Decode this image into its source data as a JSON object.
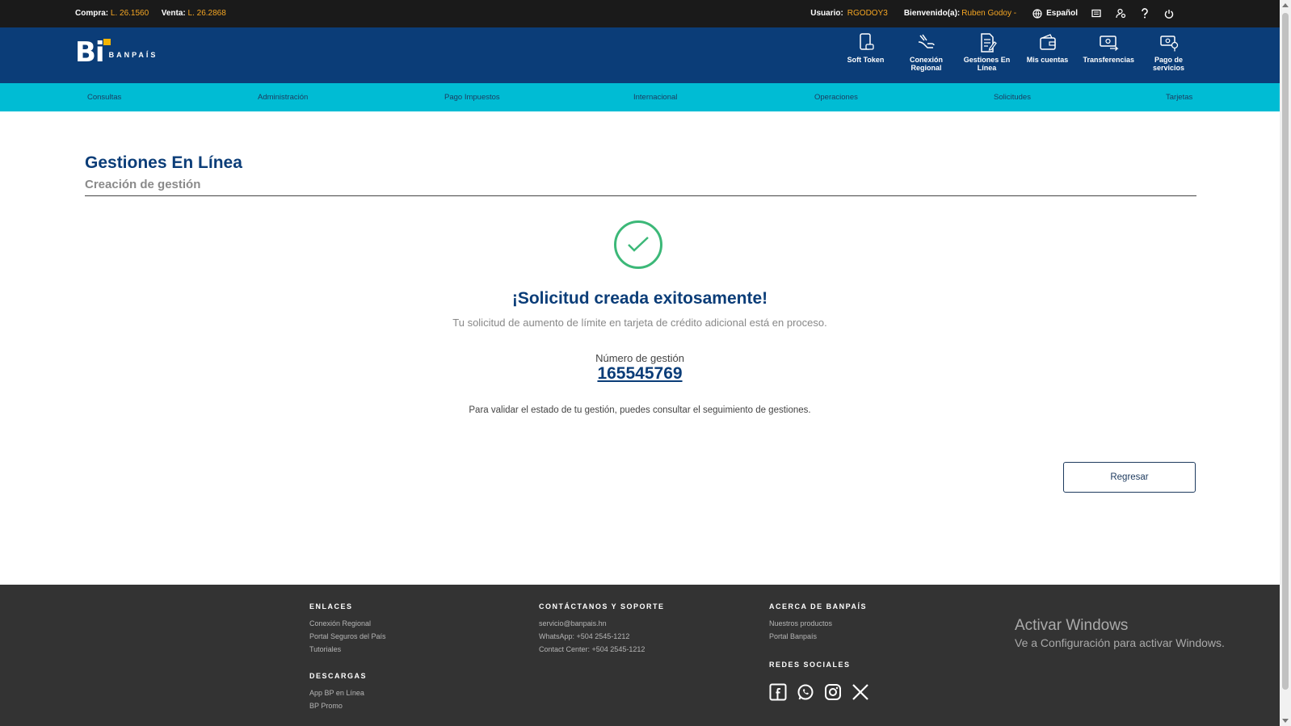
{
  "topbar": {
    "buy_label": "Compra:",
    "buy_value": "L. 26.1560",
    "sell_label": "Venta:",
    "sell_value": "L. 26.2868",
    "user_label": "Usuario:",
    "user_value": "RGODOY3",
    "welcome_label": "Bienvenido(a):",
    "welcome_value": "Ruben Godoy -",
    "language": "Español"
  },
  "header": {
    "logo_text": "Bi",
    "brand": "BANPAÍS",
    "quick_links": [
      {
        "label": "Soft Token",
        "icon": "phone-icon"
      },
      {
        "label": "Conexión Regional",
        "icon": "hand-icon"
      },
      {
        "label": "Gestiones En Línea",
        "icon": "document-icon"
      },
      {
        "label": "Mis cuentas",
        "icon": "wallet-icon"
      },
      {
        "label": "Transferencias",
        "icon": "transfer-icon"
      },
      {
        "label": "Pago de servicios",
        "icon": "service-payment-icon"
      }
    ]
  },
  "nav": {
    "items": [
      "Consultas",
      "Administración",
      "Pago Impuestos",
      "Internacional",
      "Operaciones",
      "Solicitudes",
      "Tarjetas"
    ]
  },
  "main": {
    "title": "Gestiones En Línea",
    "subtitle": "Creación de gestión",
    "success_title": "¡Solicitud creada exitosamente!",
    "success_desc": "Tu solicitud de aumento de límite en tarjeta de crédito adicional está en proceso.",
    "number_label": "Número de gestión",
    "number_value": "165545769",
    "note": "Para validar el estado de tu gestión, puedes consultar el seguimiento de gestiones.",
    "back_button": "Regresar"
  },
  "footer": {
    "links_title": "ENLACES",
    "links": [
      "Conexión Regional",
      "Portal Seguros del País",
      "Tutoriales"
    ],
    "downloads_title": "DESCARGAS",
    "downloads": [
      "App BP en Línea",
      "BP Promo"
    ],
    "contact_title": "CONTÁCTANOS Y SOPORTE",
    "contact": [
      "servicio@banpais.hn",
      "WhatsApp: +504 2545-1212",
      "Contact Center: +504 2545-1212"
    ],
    "about_title": "ACERCA DE BANPAÍS",
    "about": [
      "Nuestros productos",
      "Portal Banpaís"
    ],
    "social_title": "REDES SOCIALES",
    "social_icons": [
      "facebook-icon",
      "whatsapp-icon",
      "instagram-icon",
      "x-icon"
    ]
  },
  "windows_activation": {
    "title": "Activar Windows",
    "text": "Ve a Configuración para activar Windows."
  },
  "colors": {
    "topbar_bg": "#1a1a1a",
    "header_bg": "#0b3d78",
    "nav_bg": "#00bcd4",
    "accent": "#f5a623",
    "success": "#3cb878",
    "footer_bg": "#333333"
  }
}
